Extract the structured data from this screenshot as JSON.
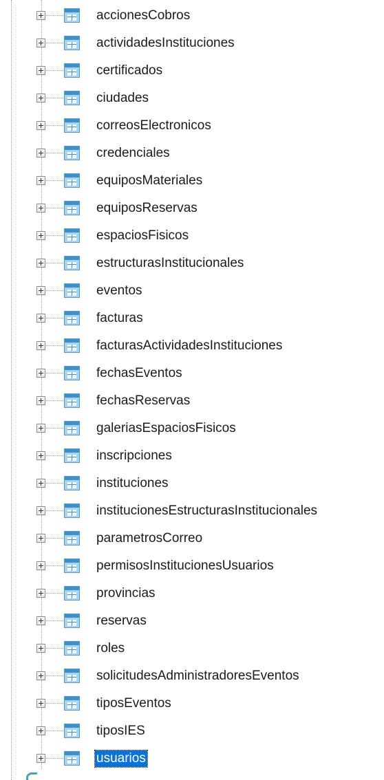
{
  "tree": {
    "items": [
      {
        "label": "accionesCobros",
        "selected": false
      },
      {
        "label": "actividadesInstituciones",
        "selected": false
      },
      {
        "label": "certificados",
        "selected": false
      },
      {
        "label": "ciudades",
        "selected": false
      },
      {
        "label": "correosElectronicos",
        "selected": false
      },
      {
        "label": "credenciales",
        "selected": false
      },
      {
        "label": "equiposMateriales",
        "selected": false
      },
      {
        "label": "equiposReservas",
        "selected": false
      },
      {
        "label": "espaciosFisicos",
        "selected": false
      },
      {
        "label": "estructurasInstitucionales",
        "selected": false
      },
      {
        "label": "eventos",
        "selected": false
      },
      {
        "label": "facturas",
        "selected": false
      },
      {
        "label": "facturasActividadesInstituciones",
        "selected": false
      },
      {
        "label": "fechasEventos",
        "selected": false
      },
      {
        "label": "fechasReservas",
        "selected": false
      },
      {
        "label": "galeriasEspaciosFisicos",
        "selected": false
      },
      {
        "label": "inscripciones",
        "selected": false
      },
      {
        "label": "instituciones",
        "selected": false
      },
      {
        "label": "institucionesEstructurasInstitucionales",
        "selected": false
      },
      {
        "label": "parametrosCorreo",
        "selected": false
      },
      {
        "label": "permisosInstitucionesUsuarios",
        "selected": false
      },
      {
        "label": "provincias",
        "selected": false
      },
      {
        "label": "reservas",
        "selected": false
      },
      {
        "label": "roles",
        "selected": false
      },
      {
        "label": "solicitudesAdministradoresEventos",
        "selected": false
      },
      {
        "label": "tiposEventos",
        "selected": false
      },
      {
        "label": "tiposIES",
        "selected": false
      },
      {
        "label": "usuarios",
        "selected": true
      }
    ],
    "icon": "table-icon",
    "expander_icon": "expand-plus-icon",
    "colors": {
      "selection": "#0a74d6",
      "selection_text": "#ffffff",
      "icon_blue": "#3f8fc9",
      "icon_fill": "#a9d4f0"
    }
  }
}
